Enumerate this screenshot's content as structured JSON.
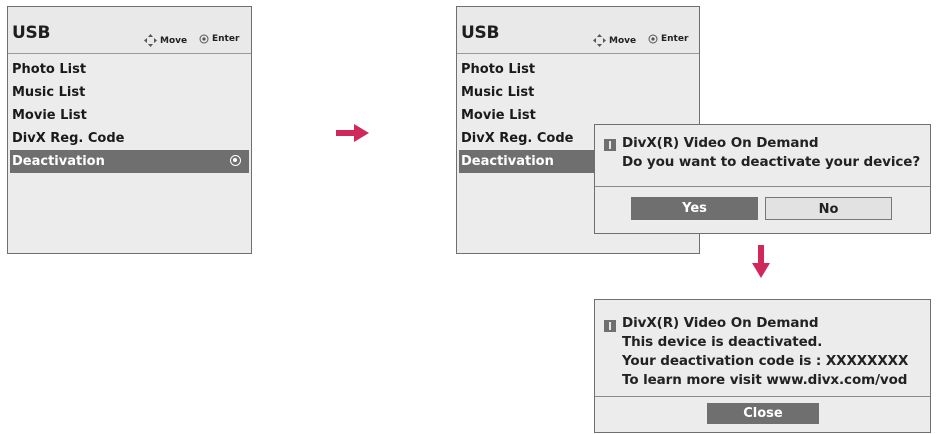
{
  "colors": {
    "arrow": "#d0285a",
    "selected_bg": "#6f6f6f",
    "panel_bg": "#ececec"
  },
  "left_panel": {
    "title": "USB",
    "hint_move": "Move",
    "hint_enter": "Enter",
    "menu": [
      {
        "label": "Photo List"
      },
      {
        "label": "Music List"
      },
      {
        "label": "Movie List"
      },
      {
        "label": "DivX Reg. Code"
      },
      {
        "label": "Deactivation",
        "selected": true
      }
    ]
  },
  "right_panel": {
    "title": "USB",
    "hint_move": "Move",
    "hint_enter": "Enter",
    "menu": [
      {
        "label": "Photo List"
      },
      {
        "label": "Music List"
      },
      {
        "label": "Movie List"
      },
      {
        "label": "DivX Reg. Code"
      },
      {
        "label": "Deactivation",
        "selected": true
      }
    ]
  },
  "confirm_dialog": {
    "line1": "DivX(R) Video On Demand",
    "line2": "Do you want to deactivate your device?",
    "yes_label": "Yes",
    "no_label": "No"
  },
  "result_dialog": {
    "line1": "DivX(R) Video On Demand",
    "line2": "This device is deactivated.",
    "line3": "Your deactivation code is : XXXXXXXX",
    "line4": "To learn more visit www.divx.com/vod",
    "close_label": "Close"
  }
}
